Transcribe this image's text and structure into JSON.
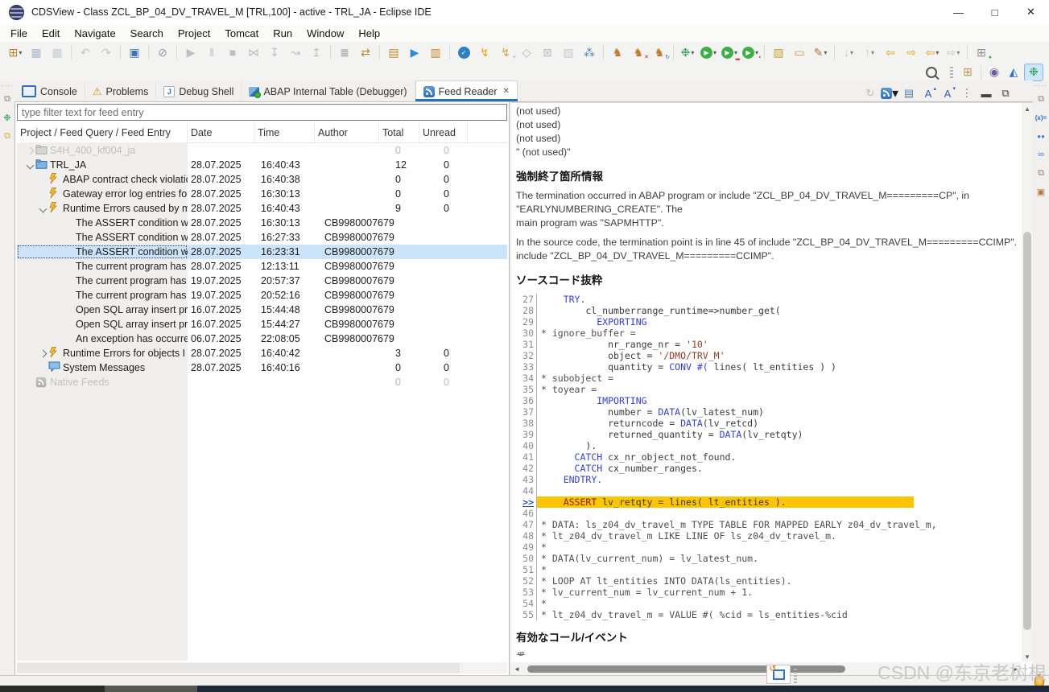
{
  "icons": {
    "dropdown": "▾",
    "close": "✕",
    "minimize": "—",
    "maximize": "□",
    "restore": "⧉",
    "menu_overflow": "⋮",
    "sort_asc": "ˆ",
    "scroll_up": "▲",
    "scroll_down": "▼",
    "scroll_left": "◄",
    "scroll_right": "►"
  },
  "window": {
    "title": "CDSView - Class ZCL_BP_04_DV_TRAVEL_M [TRL,100] - active - TRL_JA - Eclipse IDE"
  },
  "menu_bar": {
    "items": [
      "File",
      "Edit",
      "Navigate",
      "Search",
      "Project",
      "Tomcat",
      "Run",
      "Window",
      "Help"
    ]
  },
  "main_toolbar": {
    "items": [
      {
        "n": "new-wizard",
        "g": "⊞",
        "c": "#b8862b",
        "d": true
      },
      {
        "n": "save",
        "g": "▦",
        "c": "#93a7c0",
        "x": true
      },
      {
        "n": "save-all",
        "g": "▩",
        "c": "#b9c3cf",
        "x": true
      },
      {
        "n": "undo",
        "g": "↶",
        "c": "#b8b3a8",
        "x": true,
        "s": true
      },
      {
        "n": "redo",
        "g": "↷",
        "c": "#b8b3a8",
        "x": true
      },
      {
        "n": "open-console",
        "g": "▣",
        "c": "#3b72b4",
        "s": true
      },
      {
        "n": "pin-console",
        "g": "⊘",
        "c": "#8e99a4",
        "s": true
      },
      {
        "n": "resume",
        "g": "▶",
        "c": "#a9afb5",
        "x": true,
        "s": true
      },
      {
        "n": "suspend",
        "g": "‖",
        "c": "#a9afb5",
        "x": true
      },
      {
        "n": "terminate",
        "g": "■",
        "c": "#a9afb5",
        "x": true
      },
      {
        "n": "disconnect",
        "g": "⋈",
        "c": "#a9afb5",
        "x": true
      },
      {
        "n": "step-into",
        "g": "↧",
        "c": "#a9afb5",
        "x": true
      },
      {
        "n": "step-over",
        "g": "↝",
        "c": "#a9afb5",
        "x": true
      },
      {
        "n": "step-return",
        "g": "↥",
        "c": "#a9afb5",
        "x": true
      },
      {
        "n": "run-to-line",
        "g": "≣",
        "c": "#7d8089",
        "s": true
      },
      {
        "n": "use-step-filters",
        "g": "⇄",
        "c": "#b5822f"
      },
      {
        "n": "open-abap-object",
        "g": "▤",
        "c": "#c9872d",
        "s": true
      },
      {
        "n": "execute-abap-object",
        "g": "▶",
        "c": "#2e8fd0"
      },
      {
        "n": "refresh-abap-object",
        "g": "▥",
        "c": "#c9872d"
      },
      {
        "n": "check-syntax",
        "g": "✓",
        "cir": "#2f7fc1",
        "s": true
      },
      {
        "n": "activate",
        "g": "↯",
        "c": "#e2a21a"
      },
      {
        "n": "activate-multiple",
        "g": "↯",
        "c": "#c9a54c",
        "b": "+",
        "bc": "#8a8a88"
      },
      {
        "n": "data-preview",
        "g": "◇",
        "c": "#9aa2ab",
        "x": true
      },
      {
        "n": "lock-object",
        "g": "⊠",
        "c": "#a9afb5",
        "x": true
      },
      {
        "n": "transport-object",
        "g": "▧",
        "c": "#b7bdc3",
        "x": true
      },
      {
        "n": "relation-explorer",
        "g": "⁂",
        "c": "#4f7fb5"
      },
      {
        "n": "tomcat-start",
        "g": "♞",
        "c": "#c07a2e",
        "s": true
      },
      {
        "n": "tomcat-stop",
        "g": "♞",
        "c": "#c07a2e",
        "b": "✕",
        "bc": "#cc2222"
      },
      {
        "n": "tomcat-restart",
        "g": "♞",
        "c": "#c07a2e",
        "b": "↻",
        "bc": "#2e6fd0"
      },
      {
        "n": "debug",
        "g": "❉",
        "c": "#2f9e54",
        "d": true,
        "s": true
      },
      {
        "n": "run",
        "g": "▶",
        "cir": "#3fae49",
        "d": true
      },
      {
        "n": "coverage",
        "g": "▶",
        "cir": "#3fae49",
        "b": "▂",
        "bc": "#cc3333",
        "d": true
      },
      {
        "n": "profile",
        "g": "▶",
        "cir": "#3fae49",
        "b": "▪",
        "bc": "#b23a6c",
        "d": true
      },
      {
        "n": "open-type",
        "g": "▨",
        "c": "#c9a23c",
        "s": true
      },
      {
        "n": "open-resource",
        "g": "▭",
        "c": "#c9a23c"
      },
      {
        "n": "search-tool",
        "g": "✎",
        "c": "#b1783c",
        "d": true
      },
      {
        "n": "import",
        "g": "↓",
        "c": "#b9b9b7",
        "x": true,
        "d": true,
        "s": true
      },
      {
        "n": "export",
        "g": "↑",
        "c": "#b9b9b7",
        "x": true,
        "d": true
      },
      {
        "n": "previous-edit-location",
        "g": "⇦",
        "c": "#e2a21a"
      },
      {
        "n": "next-edit-location",
        "g": "⇨",
        "c": "#e2a21a"
      },
      {
        "n": "back",
        "g": "⇦",
        "c": "#e2a21a",
        "d": true
      },
      {
        "n": "forward",
        "g": "⇨",
        "c": "#b9b9b7",
        "x": true,
        "d": true
      },
      {
        "n": "pin-editor",
        "g": "⊞",
        "c": "#8a8f94",
        "b": "●",
        "bc": "#3fae49",
        "s": true
      }
    ]
  },
  "perspective_bar": {
    "items": [
      {
        "n": "open-perspective",
        "g": "⊞",
        "c": "#b99a55"
      },
      {
        "n": "java-ee-perspective",
        "g": "◉",
        "c": "#6f5a9e",
        "s": true
      },
      {
        "n": "abap-perspective",
        "g": "◭",
        "c": "#2f6fbb"
      },
      {
        "n": "debug-perspective",
        "g": "❉",
        "c": "#2f9e54",
        "selected": true
      }
    ]
  },
  "left_dock": {
    "items": [
      {
        "n": "restore-view",
        "g": "⧉",
        "c": "#8a8276"
      },
      {
        "n": "debug-view",
        "g": "❉",
        "c": "#2f9e54"
      },
      {
        "n": "copy-pages",
        "g": "⧉",
        "c": "#d9a33c"
      }
    ]
  },
  "right_dock": {
    "items": [
      {
        "n": "restore-view",
        "g": "⧉",
        "c": "#8a8276"
      },
      {
        "n": "variables-view",
        "g": "(x)=",
        "c": "#2f6fbb",
        "t": true
      },
      {
        "n": "breakpoints-view",
        "g": "●●",
        "c": "#3f7fc1",
        "t": true
      },
      {
        "n": "expressions-view",
        "g": "∞",
        "c": "#3f7fc1"
      },
      {
        "n": "restore-view-2",
        "g": "⧉",
        "c": "#8a8276"
      },
      {
        "n": "editor-view",
        "g": "▣",
        "c": "#b87b3a"
      }
    ]
  },
  "view": {
    "tabs": [
      {
        "label": "Console",
        "icon": "console"
      },
      {
        "label": "Problems",
        "icon": "problems"
      },
      {
        "label": "Debug Shell",
        "icon": "debug-shell"
      },
      {
        "label": "ABAP Internal Table (Debugger)",
        "icon": "abap-table"
      },
      {
        "label": "Feed Reader",
        "icon": "feed-reader",
        "active": true,
        "closable": true
      }
    ],
    "toolbar": [
      {
        "n": "refresh-feeds",
        "g": "↻",
        "c": "#b9b9b7",
        "x": true
      },
      {
        "n": "new-feed-query",
        "rss": true,
        "d": true
      },
      {
        "n": "print",
        "g": "▤",
        "c": "#5b83ad"
      },
      {
        "n": "increase-font",
        "g": "A",
        "c": "#2f5fae",
        "b": "▴",
        "bc": "#2f5fae"
      },
      {
        "n": "decrease-font",
        "g": "A",
        "c": "#2f5fae",
        "b": "▾",
        "bc": "#2f5fae"
      },
      {
        "n": "view-menu",
        "g": "⋮",
        "c": "#666"
      },
      {
        "n": "minimize-view",
        "g": "▬",
        "c": "#444"
      },
      {
        "n": "maximize-view",
        "g": "⧉",
        "c": "#444"
      }
    ],
    "filter_placeholder": "type filter text for feed entry",
    "table": {
      "columns": [
        "Project / Feed Query / Feed Entry",
        "Date",
        "Time",
        "Author",
        "Total",
        "Unread"
      ],
      "rows": [
        {
          "label": "S4H_400_kf004_ja",
          "level": 0,
          "exp": "col",
          "icon": "folder",
          "dis": true,
          "date": "",
          "time": "",
          "author": "",
          "total": "0",
          "unread": "0"
        },
        {
          "label": "TRL_JA",
          "level": 0,
          "exp": "exp",
          "icon": "folder",
          "date": "28.07.2025",
          "time": "16:40:43",
          "author": "",
          "total": "12",
          "unread": "0"
        },
        {
          "label": "ABAP contract check violatic",
          "level": 1,
          "icon": "query",
          "date": "28.07.2025",
          "time": "16:40:38",
          "author": "",
          "total": "0",
          "unread": "0"
        },
        {
          "label": "Gateway error log entries for",
          "level": 1,
          "icon": "query",
          "date": "28.07.2025",
          "time": "16:30:13",
          "author": "",
          "total": "0",
          "unread": "0"
        },
        {
          "label": "Runtime Errors caused by me",
          "level": 1,
          "exp": "exp",
          "icon": "query",
          "date": "28.07.2025",
          "time": "16:40:43",
          "author": "",
          "total": "9",
          "unread": "0"
        },
        {
          "label": "The ASSERT condition wa",
          "level": 2,
          "date": "28.07.2025",
          "time": "16:30:13",
          "author": "CB9980007679",
          "total": "",
          "unread": ""
        },
        {
          "label": "The ASSERT condition wa",
          "level": 2,
          "date": "28.07.2025",
          "time": "16:27:33",
          "author": "CB9980007679",
          "total": "",
          "unread": ""
        },
        {
          "label": "The ASSERT condition wa",
          "level": 2,
          "sel": true,
          "date": "28.07.2025",
          "time": "16:23:31",
          "author": "CB9980007679",
          "total": "",
          "unread": ""
        },
        {
          "label": "The current program has i",
          "level": 2,
          "date": "28.07.2025",
          "time": "12:13:11",
          "author": "CB9980007679",
          "total": "",
          "unread": ""
        },
        {
          "label": "The current program has i",
          "level": 2,
          "date": "19.07.2025",
          "time": "20:57:37",
          "author": "CB9980007679",
          "total": "",
          "unread": ""
        },
        {
          "label": "The current program has i",
          "level": 2,
          "date": "19.07.2025",
          "time": "20:52:16",
          "author": "CB9980007679",
          "total": "",
          "unread": ""
        },
        {
          "label": "Open SQL array insert pro",
          "level": 2,
          "date": "16.07.2025",
          "time": "15:44:48",
          "author": "CB9980007679",
          "total": "",
          "unread": ""
        },
        {
          "label": "Open SQL array insert pro",
          "level": 2,
          "date": "16.07.2025",
          "time": "15:44:27",
          "author": "CB9980007679",
          "total": "",
          "unread": ""
        },
        {
          "label": "An exception has occurre",
          "level": 2,
          "date": "06.07.2025",
          "time": "22:08:05",
          "author": "CB9980007679",
          "total": "",
          "unread": ""
        },
        {
          "label": "Runtime Errors for objects I a",
          "level": 1,
          "exp": "col",
          "icon": "query",
          "date": "28.07.2025",
          "time": "16:40:42",
          "author": "",
          "total": "3",
          "unread": "0"
        },
        {
          "label": "System Messages",
          "level": 1,
          "icon": "messages",
          "date": "28.07.2025",
          "time": "16:40:16",
          "author": "",
          "total": "0",
          "unread": "0"
        },
        {
          "label": "Native Feeds",
          "level": 0,
          "icon": "rss",
          "dis": true,
          "date": "",
          "time": "",
          "author": "",
          "total": "0",
          "unread": "0"
        }
      ]
    }
  },
  "detail": {
    "not_used_lines": [
      "(not used)",
      "(not used)",
      "(not used)",
      "\" (not used)\""
    ],
    "heading1": "強制終了箇所情報",
    "para1": "The termination occurred in ABAP program or include \"ZCL_BP_04_DV_TRAVEL_M=========CP\", in\n\"EARLYNUMBERING_CREATE\". The\nmain program was \"SAPMHTTP\".",
    "para2": "In the source code, the termination point is in line 45 of include \"ZCL_BP_04_DV_TRAVEL_M=========CCIMP\".\ninclude \"ZCL_BP_04_DV_TRAVEL_M=========CCIMP\".",
    "heading2": "ソースコード抜粋",
    "code": [
      {
        "n": "27",
        "t": [
          [
            "    ",
            "p"
          ],
          [
            "TRY.",
            "k"
          ]
        ]
      },
      {
        "n": "28",
        "t": [
          [
            "        cl_numberrange_runtime=>number_get(",
            "p"
          ]
        ]
      },
      {
        "n": "29",
        "t": [
          [
            "          ",
            "p"
          ],
          [
            "EXPORTING",
            "k"
          ]
        ]
      },
      {
        "n": "30",
        "t": [
          [
            "* ignore_buffer =",
            "c"
          ]
        ]
      },
      {
        "n": "31",
        "t": [
          [
            "            nr_range_nr = ",
            "p"
          ],
          [
            "'10'",
            "s"
          ]
        ]
      },
      {
        "n": "32",
        "t": [
          [
            "            object = ",
            "p"
          ],
          [
            "'/DMO/TRV_M'",
            "s"
          ]
        ]
      },
      {
        "n": "33",
        "t": [
          [
            "            quantity = ",
            "p"
          ],
          [
            "CONV",
            "k"
          ],
          [
            " #( ",
            "k"
          ],
          [
            "lines( lt_entities ) )",
            "p"
          ]
        ]
      },
      {
        "n": "34",
        "t": [
          [
            "* subobject =",
            "c"
          ]
        ]
      },
      {
        "n": "35",
        "t": [
          [
            "* toyear =",
            "c"
          ]
        ]
      },
      {
        "n": "36",
        "t": [
          [
            "          ",
            "p"
          ],
          [
            "IMPORTING",
            "k"
          ]
        ]
      },
      {
        "n": "37",
        "t": [
          [
            "            number = ",
            "p"
          ],
          [
            "DATA",
            "k"
          ],
          [
            "(lv_latest_num)",
            "p"
          ]
        ]
      },
      {
        "n": "38",
        "t": [
          [
            "            returncode = ",
            "p"
          ],
          [
            "DATA",
            "k"
          ],
          [
            "(lv_retcd)",
            "p"
          ]
        ]
      },
      {
        "n": "39",
        "t": [
          [
            "            returned_quantity = ",
            "p"
          ],
          [
            "DATA",
            "k"
          ],
          [
            "(lv_retqty)",
            "p"
          ]
        ]
      },
      {
        "n": "40",
        "t": [
          [
            "        ).",
            "p"
          ]
        ]
      },
      {
        "n": "41",
        "t": [
          [
            "      ",
            "p"
          ],
          [
            "CATCH",
            "k"
          ],
          [
            " cx_nr_object_not_found.",
            "p"
          ]
        ]
      },
      {
        "n": "42",
        "t": [
          [
            "      ",
            "p"
          ],
          [
            "CATCH",
            "k"
          ],
          [
            " cx_number_ranges.",
            "p"
          ]
        ]
      },
      {
        "n": "43",
        "t": [
          [
            "    ",
            "p"
          ],
          [
            "ENDTRY.",
            "k"
          ]
        ]
      },
      {
        "n": "44",
        "t": []
      },
      {
        "n": "45",
        "marker": ">>",
        "hl": true,
        "t": [
          [
            "    ",
            "h"
          ],
          [
            "ASSERT",
            "e"
          ],
          [
            " lv_retqty = lines( lt_entities ).",
            "h"
          ]
        ]
      },
      {
        "n": "46",
        "t": []
      },
      {
        "n": "47",
        "t": [
          [
            "* DATA: ls_z04_dv_travel_m TYPE TABLE FOR MAPPED EARLY z04_dv_travel_m,",
            "c"
          ]
        ]
      },
      {
        "n": "48",
        "t": [
          [
            "* lt_z04_dv_travel_m LIKE LINE OF ls_z04_dv_travel_m.",
            "c"
          ]
        ]
      },
      {
        "n": "49",
        "t": [
          [
            "*",
            "c"
          ]
        ]
      },
      {
        "n": "50",
        "t": [
          [
            "* DATA(lv_current_num) = lv_latest_num.",
            "c"
          ]
        ]
      },
      {
        "n": "51",
        "t": [
          [
            "*",
            "c"
          ]
        ]
      },
      {
        "n": "52",
        "t": [
          [
            "* LOOP AT lt_entities INTO DATA(ls_entities).",
            "c"
          ]
        ]
      },
      {
        "n": "53",
        "t": [
          [
            "* lv_current_num = lv_current_num + 1.",
            "c"
          ]
        ]
      },
      {
        "n": "54",
        "t": [
          [
            "*",
            "c"
          ]
        ]
      },
      {
        "n": "55",
        "t": [
          [
            "* lt_z04_dv_travel_m = VALUE #( %cid = ls_entities-%cid",
            "c"
          ]
        ]
      }
    ],
    "heading3": "有効なコール/イベント",
    "clipped": "番"
  },
  "watermark": "CSDN @东京老树根"
}
